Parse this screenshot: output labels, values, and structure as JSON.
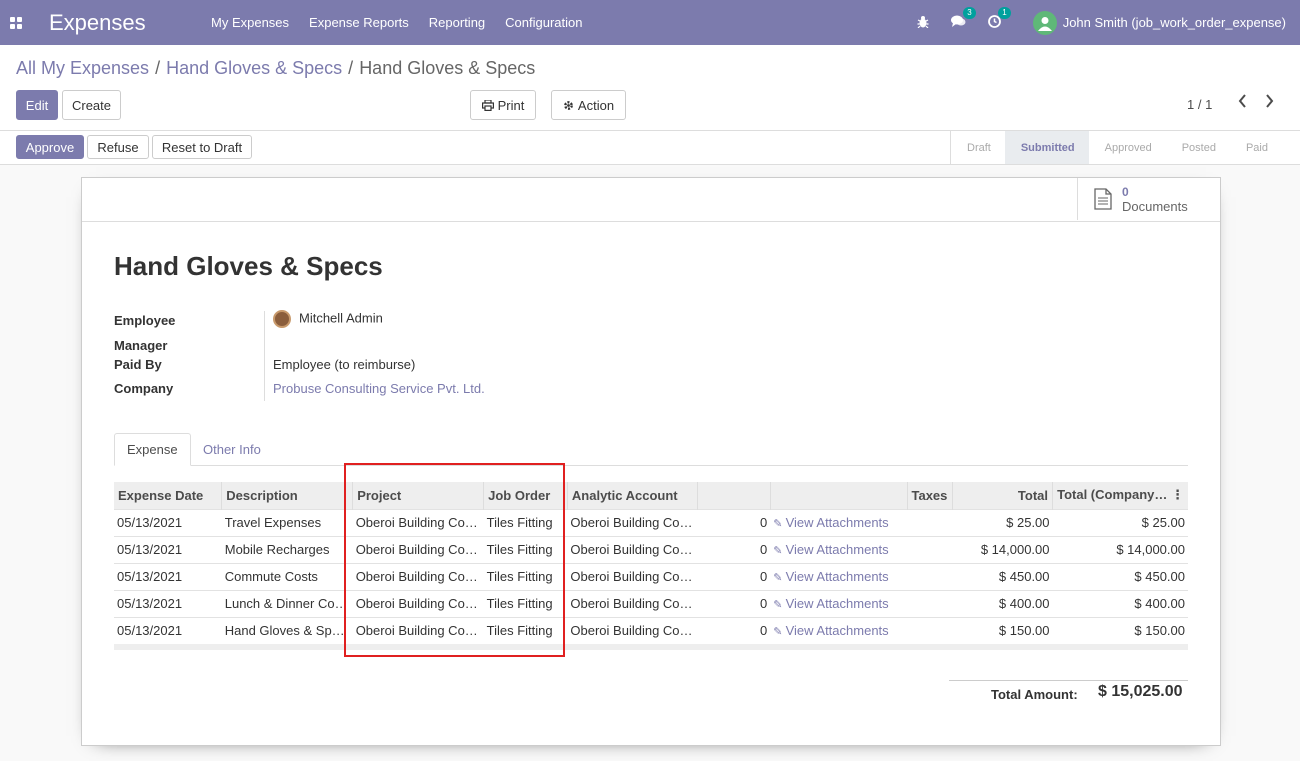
{
  "navbar": {
    "app_name": "Expenses",
    "menu": [
      "My Expenses",
      "Expense Reports",
      "Reporting",
      "Configuration"
    ],
    "messages_count": "3",
    "activities_count": "1",
    "user": "John Smith (job_work_order_expense)",
    "bg_color": "#7c7bad"
  },
  "breadcrumb": {
    "items": [
      "All My Expenses",
      "Hand Gloves & Specs"
    ],
    "current": "Hand Gloves & Specs",
    "separator": "/"
  },
  "buttons": {
    "edit": "Edit",
    "create": "Create",
    "print": "Print",
    "action": "Action",
    "approve": "Approve",
    "refuse": "Refuse",
    "reset": "Reset to Draft"
  },
  "pager": {
    "value": "1 / 1"
  },
  "statusbar": {
    "stages": [
      "Draft",
      "Submitted",
      "Approved",
      "Posted",
      "Paid"
    ],
    "active": "Submitted"
  },
  "smart_button": {
    "count": "0",
    "label": "Documents"
  },
  "record": {
    "title": "Hand Gloves & Specs",
    "fields": {
      "employee_label": "Employee",
      "employee_value": "Mitchell Admin",
      "manager_label": "Manager",
      "manager_value": "",
      "paid_by_label": "Paid By",
      "paid_by_value": "Employee (to reimburse)",
      "company_label": "Company",
      "company_value": "Probuse Consulting Service Pvt. Ltd."
    }
  },
  "tabs": [
    "Expense",
    "Other Info"
  ],
  "table": {
    "headers": [
      "Expense Date",
      "Description",
      "Project",
      "Job Order",
      "Analytic Account",
      "",
      "",
      "Taxes",
      "Total",
      "Total (Company…"
    ],
    "rows": [
      [
        "05/13/2021",
        "Travel Expenses",
        "Oberoi Building Co…",
        "Tiles Fitting",
        "Oberoi Building Co…",
        "0",
        "View Attachments",
        "",
        "$ 25.00",
        "$ 25.00"
      ],
      [
        "05/13/2021",
        "Mobile Recharges",
        "Oberoi Building Co…",
        "Tiles Fitting",
        "Oberoi Building Co…",
        "0",
        "View Attachments",
        "",
        "$ 14,000.00",
        "$ 14,000.00"
      ],
      [
        "05/13/2021",
        "Commute Costs",
        "Oberoi Building Co…",
        "Tiles Fitting",
        "Oberoi Building Co…",
        "0",
        "View Attachments",
        "",
        "$ 450.00",
        "$ 450.00"
      ],
      [
        "05/13/2021",
        "Lunch & Dinner Co…",
        "Oberoi Building Co…",
        "Tiles Fitting",
        "Oberoi Building Co…",
        "0",
        "View Attachments",
        "",
        "$ 400.00",
        "$ 400.00"
      ],
      [
        "05/13/2021",
        "Hand Gloves & Sp…",
        "Oberoi Building Co…",
        "Tiles Fitting",
        "Oberoi Building Co…",
        "0",
        "View Attachments",
        "",
        "$ 150.00",
        "$ 150.00"
      ]
    ]
  },
  "total": {
    "label": "Total Amount:",
    "value": "$ 15,025.00"
  },
  "highlight_color": "#e02020"
}
